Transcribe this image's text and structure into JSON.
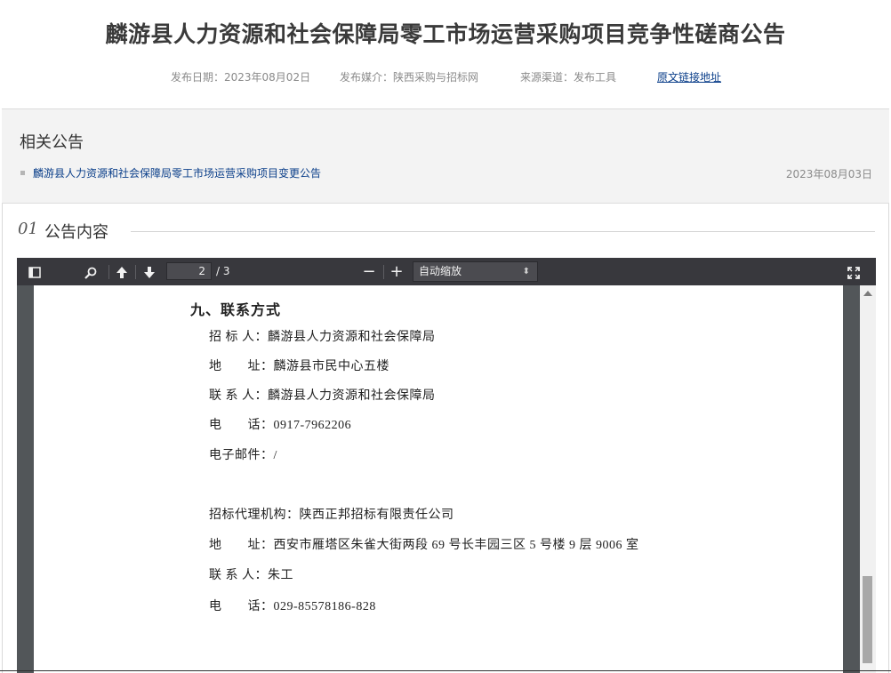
{
  "header": {
    "title": "麟游县人力资源和社会保障局零工市场运营采购项目竞争性磋商公告",
    "publish_date": "发布日期：2023年08月02日",
    "publish_media": "发布媒介：陕西采购与招标网",
    "source_channel": "来源渠道：发布工具",
    "original_link": "原文链接地址"
  },
  "related": {
    "title": "相关公告",
    "items": [
      {
        "label": "麟游县人力资源和社会保障局零工市场运营采购项目变更公告",
        "date": "2023年08月03日"
      }
    ]
  },
  "section": {
    "number": "01",
    "label": "公告内容"
  },
  "pdf_viewer": {
    "current_page": "2",
    "page_count": "/ 3",
    "zoom": "自动缩放",
    "icons": [
      "sidebar-toggle-icon",
      "search-icon",
      "previous-page-icon",
      "next-page-icon",
      "zoom-out-icon",
      "zoom-in-icon",
      "presentation-mode-icon"
    ],
    "content": {
      "heading": "九、联系方式",
      "lines": [
        "招 标 人：麟游县人力资源和社会保障局",
        "地　　址：麟游县市民中心五楼",
        "联 系 人：麟游县人力资源和社会保障局",
        "电　　话：0917-7962206",
        "电子邮件：/",
        "招标代理机构：陕西正邦招标有限责任公司",
        "地　　址：西安市雁塔区朱雀大街两段 69 号长丰园三区 5 号楼 9 层 9006 室",
        "联 系 人：朱工",
        "电　　话：029-85578186-828"
      ]
    }
  }
}
